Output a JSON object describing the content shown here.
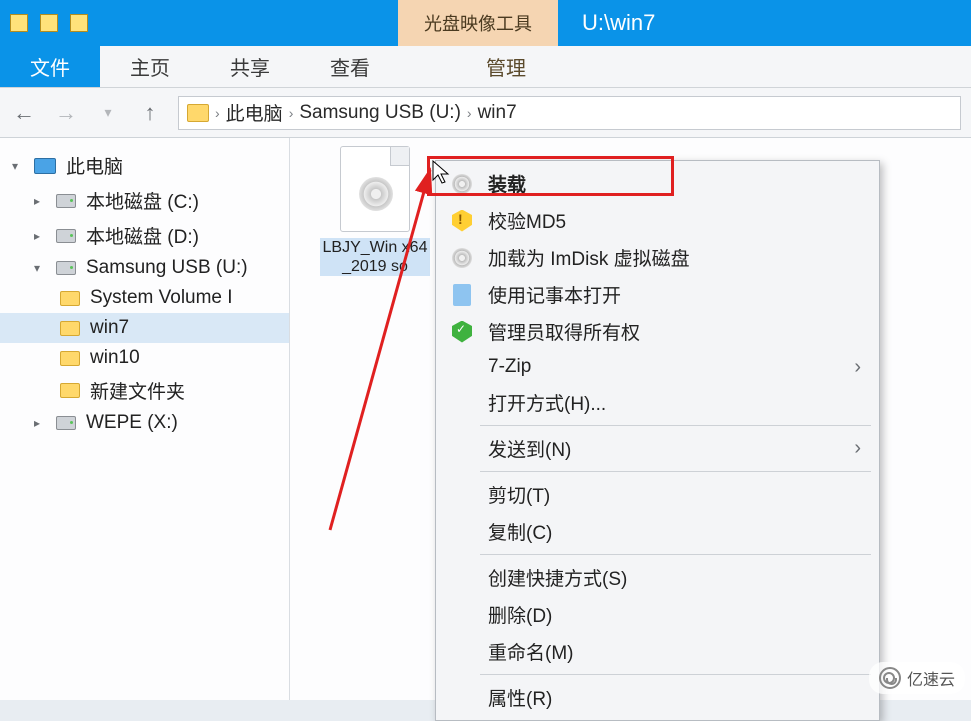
{
  "titlebar": {
    "tool_tab": "光盘映像工具",
    "path": "U:\\win7"
  },
  "ribbon": {
    "file": "文件",
    "home": "主页",
    "share": "共享",
    "view": "查看",
    "manage": "管理"
  },
  "breadcrumb": {
    "root": "此电脑",
    "drive": "Samsung USB (U:)",
    "folder": "win7"
  },
  "tree": {
    "pc": "此电脑",
    "local_c": "本地磁盘 (C:)",
    "local_d": "本地磁盘 (D:)",
    "usb": "Samsung USB (U:)",
    "svi": "System Volume I",
    "win7": "win7",
    "win10": "win10",
    "newfolder": "新建文件夹",
    "wepe": "WEPE (X:)"
  },
  "file": {
    "name": "LBJY_Win x64_2019 so"
  },
  "ctx": {
    "mount": "装载",
    "md5": "校验MD5",
    "imdisk": "加载为 ImDisk 虚拟磁盘",
    "notepad": "使用记事本打开",
    "admin_own": "管理员取得所有权",
    "sevenzip": "7-Zip",
    "open_with": "打开方式(H)...",
    "send_to": "发送到(N)",
    "cut": "剪切(T)",
    "copy": "复制(C)",
    "shortcut": "创建快捷方式(S)",
    "delete": "删除(D)",
    "rename": "重命名(M)",
    "props": "属性(R)"
  },
  "watermark": "亿速云"
}
